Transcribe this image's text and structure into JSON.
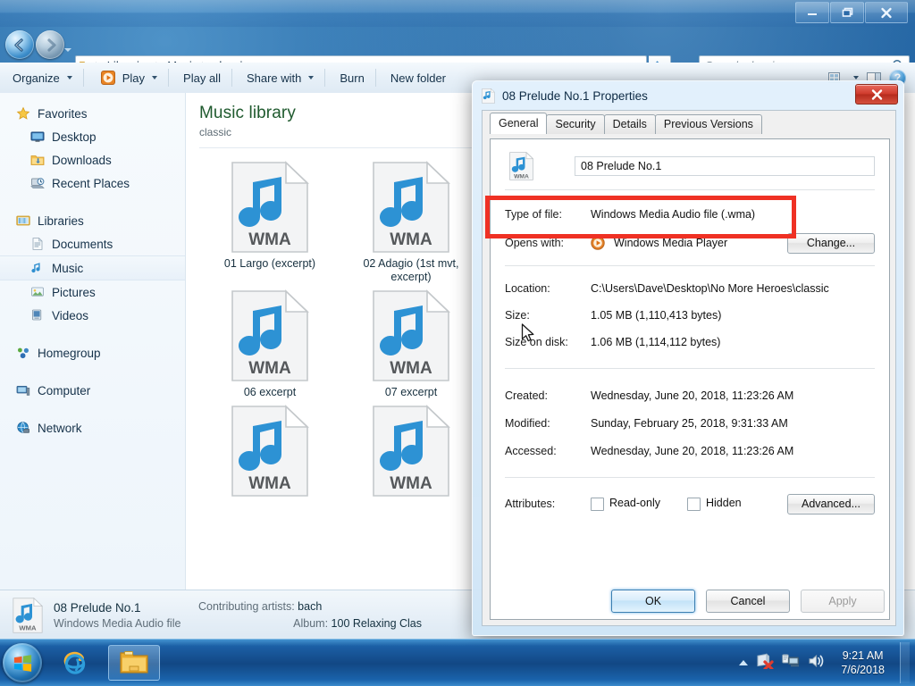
{
  "window": {
    "titlebar_buttons": [
      "minimize",
      "restore",
      "close"
    ],
    "address": {
      "crumbs": [
        "Libraries",
        "Music",
        "classic"
      ],
      "dropdown_icon": "chevron-down-icon",
      "refresh_icon": "refresh-icon"
    },
    "search": {
      "placeholder": "Search classic",
      "value": "",
      "icon": "search-icon"
    }
  },
  "toolbar": {
    "organize": "Organize",
    "play": "Play",
    "play_all": "Play all",
    "share_with": "Share with",
    "burn": "Burn",
    "new_folder": "New folder",
    "help_label": "?"
  },
  "sidebar": {
    "groups": [
      {
        "header": {
          "label": "Favorites",
          "icon": "star-icon"
        },
        "items": [
          {
            "label": "Desktop",
            "icon": "desktop-icon",
            "selected": false
          },
          {
            "label": "Downloads",
            "icon": "downloads-folder-icon",
            "selected": false
          },
          {
            "label": "Recent Places",
            "icon": "recent-places-icon",
            "selected": false
          }
        ]
      },
      {
        "header": {
          "label": "Libraries",
          "icon": "libraries-icon"
        },
        "items": [
          {
            "label": "Documents",
            "icon": "documents-library-icon",
            "selected": false
          },
          {
            "label": "Music",
            "icon": "music-library-icon",
            "selected": true
          },
          {
            "label": "Pictures",
            "icon": "pictures-library-icon",
            "selected": false
          },
          {
            "label": "Videos",
            "icon": "videos-library-icon",
            "selected": false
          }
        ]
      },
      {
        "header": {
          "label": "Homegroup",
          "icon": "homegroup-icon"
        },
        "items": []
      },
      {
        "header": {
          "label": "Computer",
          "icon": "computer-icon"
        },
        "items": []
      },
      {
        "header": {
          "label": "Network",
          "icon": "network-icon"
        },
        "items": []
      }
    ]
  },
  "content": {
    "library_title": "Music library",
    "library_subtitle": "classic",
    "files": [
      {
        "name": "01 Largo (excerpt)",
        "icon": "wma-file-icon",
        "badge": "WMA"
      },
      {
        "name": "02 Adagio (1st mvt, excerpt)",
        "icon": "wma-file-icon",
        "badge": "WMA"
      },
      {
        "name": "06 excerpt",
        "icon": "wma-file-icon",
        "badge": "WMA"
      },
      {
        "name": "07 excerpt",
        "icon": "wma-file-icon",
        "badge": "WMA"
      },
      {
        "name": "",
        "icon": "wma-file-icon",
        "badge": "WMA"
      },
      {
        "name": "",
        "icon": "wma-file-icon",
        "badge": "WMA"
      }
    ]
  },
  "details_pane": {
    "icon": "wma-file-icon",
    "file_name": "08 Prelude No.1",
    "file_kind": "Windows Media Audio file",
    "contributing_artists_label": "Contributing artists:",
    "contributing_artists_value": "bach",
    "album_label": "Album:",
    "album_value": "100 Relaxing Clas"
  },
  "dialog": {
    "title": "08 Prelude No.1 Properties",
    "icon": "wma-file-icon",
    "close_label": "✕",
    "tabs": [
      {
        "label": "General",
        "active": true
      },
      {
        "label": "Security",
        "active": false
      },
      {
        "label": "Details",
        "active": false
      },
      {
        "label": "Previous Versions",
        "active": false
      }
    ],
    "file_name": "08 Prelude No.1",
    "rows": [
      {
        "label": "Type of file:",
        "value": "Windows Media Audio file (.wma)",
        "highlighted": true
      },
      {
        "label": "Opens with:",
        "value": "Windows Media Player",
        "button": "Change..."
      },
      {
        "label": "Location:",
        "value": "C:\\Users\\Dave\\Desktop\\No More Heroes\\classic"
      },
      {
        "label": "Size:",
        "value": "1.05 MB (1,110,413 bytes)"
      },
      {
        "label": "Size on disk:",
        "value": "1.06 MB (1,114,112 bytes)"
      },
      {
        "label": "Created:",
        "value": "Wednesday, June 20, 2018, 11:23:26 AM"
      },
      {
        "label": "Modified:",
        "value": "Sunday, February 25, 2018, 9:31:33 AM"
      },
      {
        "label": "Accessed:",
        "value": "Wednesday, June 20, 2018, 11:23:26 AM"
      }
    ],
    "attributes": {
      "label": "Attributes:",
      "read_only": {
        "label": "Read-only",
        "checked": false
      },
      "hidden": {
        "label": "Hidden",
        "checked": false
      },
      "advanced_button": "Advanced..."
    },
    "footer": {
      "ok": "OK",
      "cancel": "Cancel",
      "apply": "Apply"
    },
    "highlight_color": "#ef3124"
  },
  "taskbar": {
    "start_icon": "windows-start-orb-icon",
    "pinned": [
      {
        "icon": "internet-explorer-icon",
        "active": false
      },
      {
        "icon": "windows-explorer-icon",
        "active": true
      }
    ],
    "tray": [
      {
        "icon": "network-error-icon"
      },
      {
        "icon": "action-center-icon"
      },
      {
        "icon": "volume-icon"
      }
    ],
    "clock_time": "9:21 AM",
    "clock_date": "7/6/2018"
  }
}
